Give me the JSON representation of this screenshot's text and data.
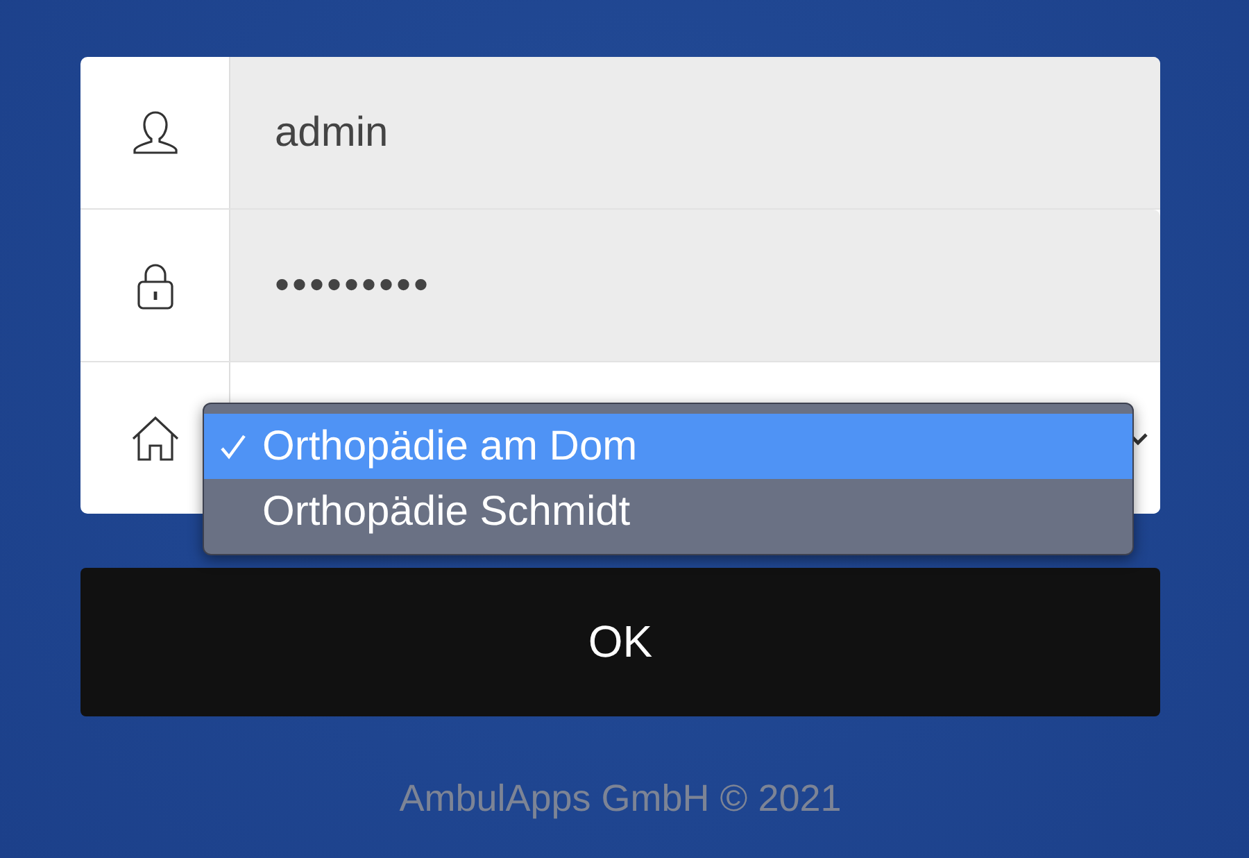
{
  "login_form": {
    "fields": [
      {
        "kind": "username",
        "value": "admin"
      },
      {
        "kind": "password",
        "value": "•••••••••"
      },
      {
        "kind": "practice",
        "open": true,
        "options": [
          {
            "label": "Orthopädie am Dom",
            "selected": true
          },
          {
            "label": "Orthopädie Schmidt",
            "selected": false
          }
        ]
      }
    ]
  },
  "submit_button": "OK",
  "footer": "AmbulApps GmbH © 2021"
}
